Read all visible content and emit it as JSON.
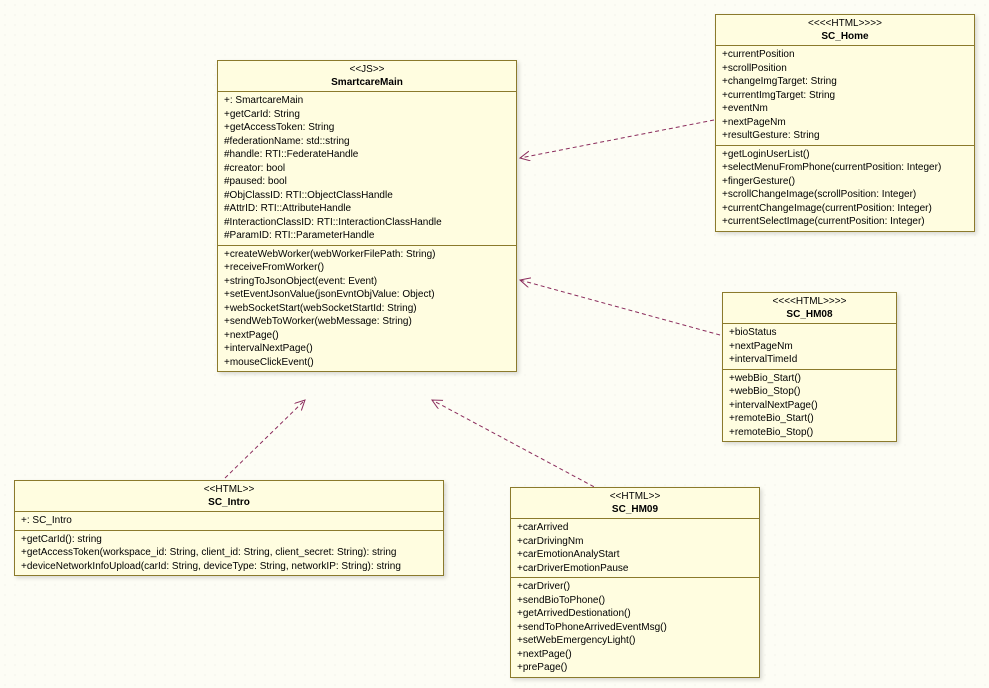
{
  "classes": {
    "smartcareMain": {
      "stereotype": "<<JS>>",
      "name": "SmartcareMain",
      "attrs": [
        "+: SmartcareMain",
        "+getCarId: String",
        "+getAccessToken: String",
        "#federationName: std::string",
        "#handle: RTI::FederateHandle",
        "#creator: bool",
        "#paused: bool",
        "#ObjClassID: RTI::ObjectClassHandle",
        "#AttrID: RTI::AttributeHandle",
        "#InteractionClassID: RTI::InteractionClassHandle",
        "#ParamID: RTI::ParameterHandle"
      ],
      "ops": [
        "+createWebWorker(webWorkerFilePath: String)",
        "+receiveFromWorker()",
        "+stringToJsonObject(event: Event)",
        "+setEventJsonValue(jsonEvntObjValue: Object)",
        "+webSocketStart(webSocketStartId: String)",
        "+sendWebToWorker(webMessage: String)",
        "+nextPage()",
        "+intervalNextPage()",
        "+mouseClickEvent()"
      ]
    },
    "scHome": {
      "stereotype": "<<<<HTML>>>>",
      "name": "SC_Home",
      "attrs": [
        "+currentPosition",
        "+scrollPosition",
        "+changeImgTarget: String",
        "+currentImgTarget: String",
        "+eventNm",
        "+nextPageNm",
        "+resultGesture: String"
      ],
      "ops": [
        "+getLoginUserList()",
        "+selectMenuFromPhone(currentPosition: Integer)",
        "+fingerGesture()",
        "+scrollChangeImage(scrollPosition: Integer)",
        "+currentChangeImage(currentPosition: Integer)",
        "+currentSelectImage(currentPosition: Integer)"
      ]
    },
    "scHM08": {
      "stereotype": "<<<<HTML>>>>",
      "name": "SC_HM08",
      "attrs": [
        "+bioStatus",
        "+nextPageNm",
        "+intervalTimeId"
      ],
      "ops": [
        "+webBio_Start()",
        "+webBio_Stop()",
        "+intervalNextPage()",
        "+remoteBio_Start()",
        "+remoteBio_Stop()"
      ]
    },
    "scHM09": {
      "stereotype": "<<HTML>>",
      "name": "SC_HM09",
      "attrs": [
        "+carArrived",
        "+carDrivingNm",
        "+carEmotionAnalyStart",
        "+carDriverEmotionPause"
      ],
      "ops": [
        "+carDriver()",
        "+sendBioToPhone()",
        "+getArrivedDestionation()",
        "+sendToPhoneArrivedEventMsg()",
        "+setWebEmergencyLight()",
        "+nextPage()",
        "+prePage()"
      ]
    },
    "scIntro": {
      "stereotype": "<<HTML>>",
      "name": "SC_Intro",
      "attrs": [
        "+: SC_Intro"
      ],
      "ops": [
        "+getCarId(): string",
        "+getAccessToken(workspace_id: String, client_id: String, client_secret: String): string",
        "+deviceNetworkInfoUpload(carId: String, deviceType: String, networkIP: String): string"
      ]
    }
  }
}
